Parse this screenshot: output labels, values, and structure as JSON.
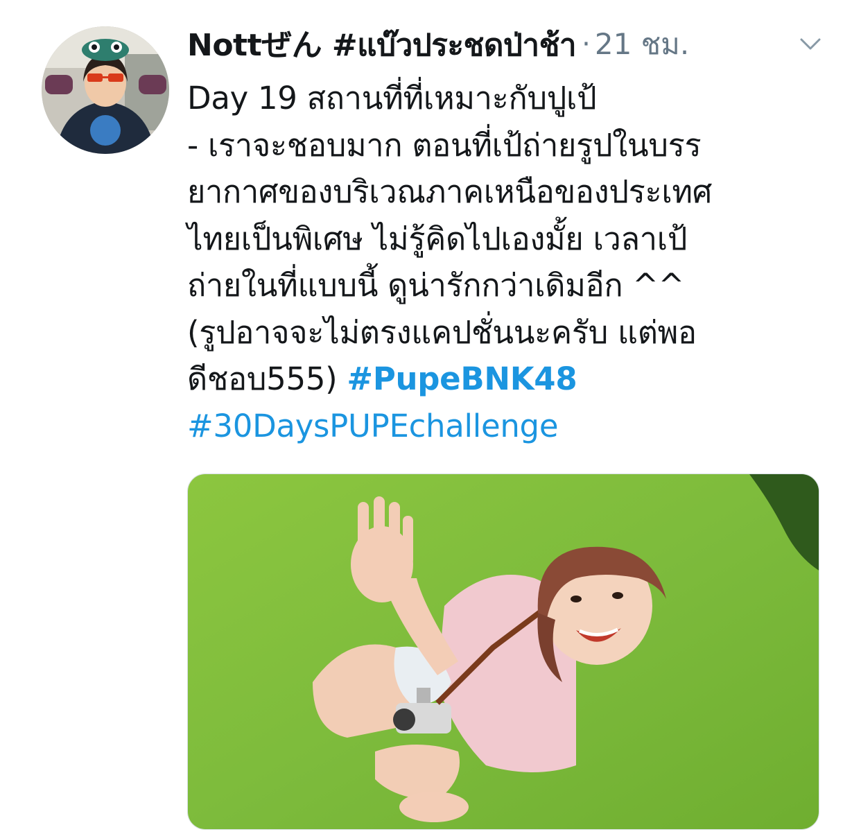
{
  "tweet": {
    "display_name": "Nottぜん #แบ๊วประชดป่าช้า",
    "separator": "·",
    "timestamp": "21 ชม.",
    "menu_icon": "chevron-down-icon",
    "avatar_icon": "user-avatar",
    "text_lines": [
      "Day 19 สถานที่ที่เหมาะกับปูเป้",
      "- เราจะชอบมาก ตอนที่เป้ถ่ายรูปในบรร",
      "ยากาศของบริเวณภาคเหนือของประเทศ",
      "ไทยเป็นพิเศษ ไม่รู้คิดไปเองมั้ย เวลาเป้",
      "ถ่ายในที่แบบนี้ ดูน่ารักกว่าเดิมอีก ^^",
      "(รูปอาจจะไม่ตรงแคปชั่นนะครับ แต่พอ",
      "ดีชอบ555) "
    ],
    "hashtag_1": "#PupeBNK48",
    "hashtag_2": "#30DaysPUPEchallenge",
    "media_alt": "photo"
  },
  "colors": {
    "text": "#14171a",
    "secondary": "#657786",
    "link": "#1b95e0",
    "grass": "#7dbb3c"
  }
}
